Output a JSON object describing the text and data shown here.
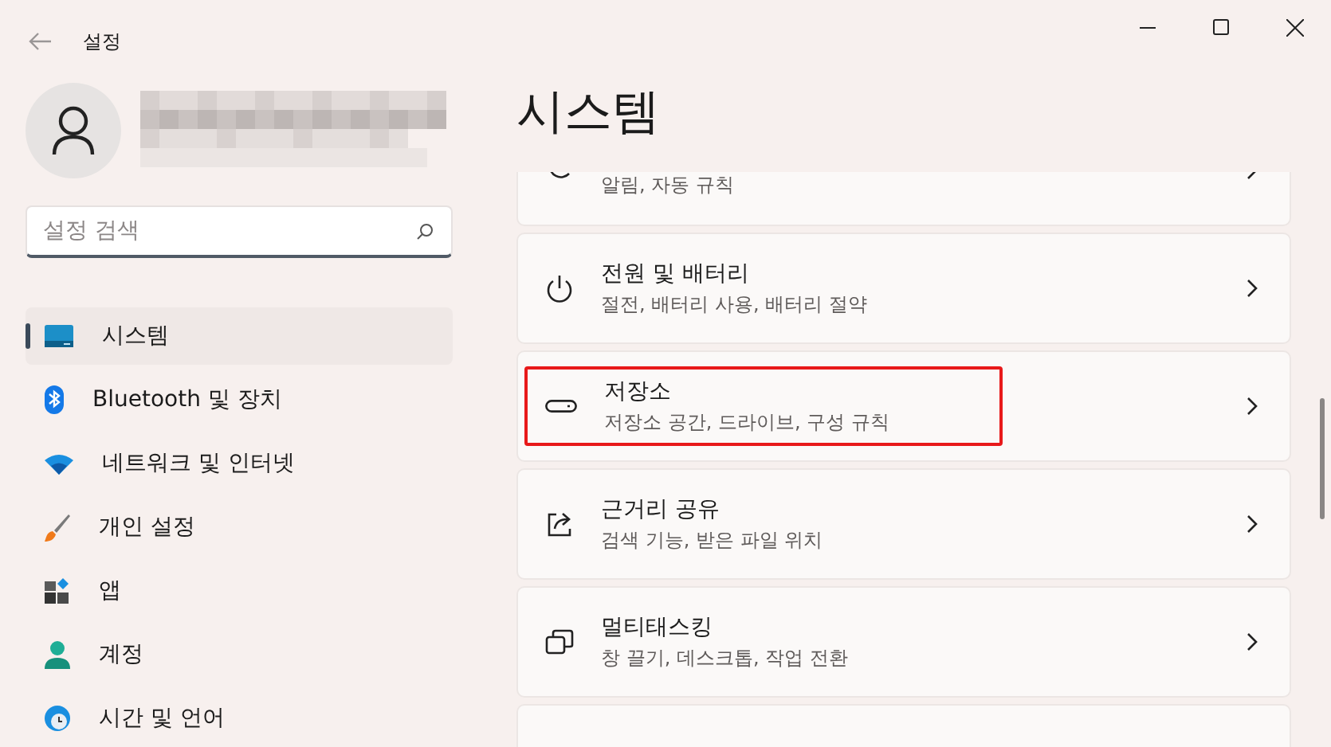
{
  "window": {
    "title": "설정"
  },
  "search": {
    "placeholder": "설정 검색"
  },
  "nav": [
    {
      "label": "시스템",
      "kind": "system",
      "selected": true
    },
    {
      "label": "Bluetooth 및 장치",
      "kind": "bluetooth",
      "selected": false
    },
    {
      "label": "네트워크 및 인터넷",
      "kind": "network",
      "selected": false
    },
    {
      "label": "개인 설정",
      "kind": "brush",
      "selected": false
    },
    {
      "label": "앱",
      "kind": "apps",
      "selected": false
    },
    {
      "label": "계정",
      "kind": "account",
      "selected": false
    },
    {
      "label": "시간 및 언어",
      "kind": "time",
      "selected": false
    }
  ],
  "page": {
    "title": "시스템"
  },
  "cards": [
    {
      "kind": "notifications",
      "subtitle": "알림, 자동 규칙",
      "highlighted": false
    },
    {
      "kind": "power",
      "title": "전원 및 배터리",
      "subtitle": "절전, 배터리 사용, 배터리 절약",
      "highlighted": false
    },
    {
      "kind": "storage",
      "title": "저장소",
      "subtitle": "저장소 공간, 드라이브, 구성 규칙",
      "highlighted": true
    },
    {
      "kind": "share",
      "title": "근거리 공유",
      "subtitle": "검색 기능, 받은 파일 위치",
      "highlighted": false
    },
    {
      "kind": "multitask",
      "title": "멀티태스킹",
      "subtitle": "창 끌기, 데스크톱, 작업 전환",
      "highlighted": false
    },
    {
      "highlighted": false
    }
  ]
}
